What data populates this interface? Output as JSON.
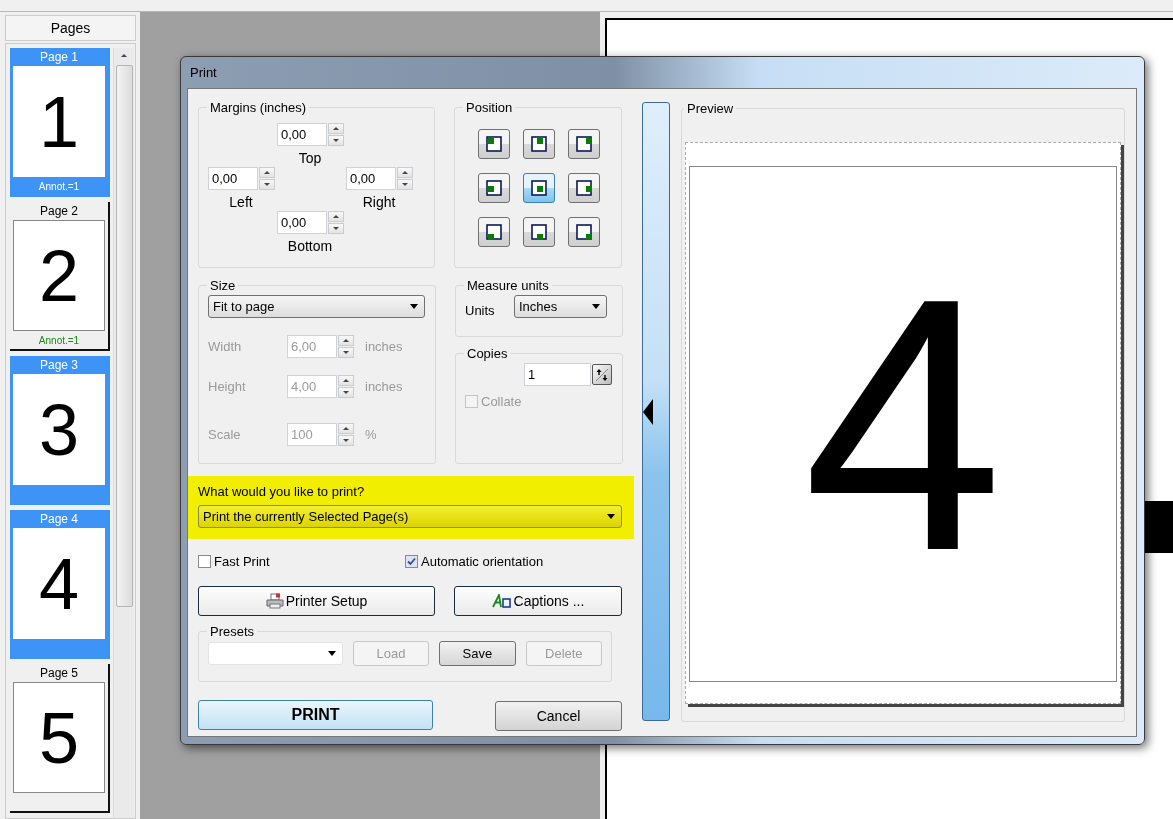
{
  "sidebar": {
    "title": "Pages",
    "pages": [
      {
        "label": "Page 1",
        "digit": "1",
        "annotation": "Annot.=1",
        "selected": true
      },
      {
        "label": "Page 2",
        "digit": "2",
        "annotation": "Annot.=1",
        "selected": false
      },
      {
        "label": "Page 3",
        "digit": "3",
        "selected": true
      },
      {
        "label": "Page 4",
        "digit": "4",
        "selected": true
      },
      {
        "label": "Page 5",
        "digit": "5",
        "selected": false
      }
    ]
  },
  "dialog": {
    "title": "Print",
    "margins": {
      "title": "Margins (inches)",
      "fields": [
        {
          "label": "Top",
          "value": "0,00"
        },
        {
          "label": "Left",
          "value": "0,00"
        },
        {
          "label": "Right",
          "value": "0,00"
        },
        {
          "label": "Bottom",
          "value": "0,00"
        }
      ]
    },
    "position": {
      "title": "Position",
      "cells": [
        {
          "selected": false
        },
        {
          "selected": false
        },
        {
          "selected": false
        },
        {
          "selected": false
        },
        {
          "selected": true
        },
        {
          "selected": false
        },
        {
          "selected": false
        },
        {
          "selected": false
        },
        {
          "selected": false
        }
      ]
    },
    "size": {
      "title": "Size",
      "mode": "Fit to page",
      "fields": [
        {
          "label": "Width",
          "value": "6,00",
          "unit": "inches",
          "disabled": true
        },
        {
          "label": "Height",
          "value": "4,00",
          "unit": "inches",
          "disabled": true
        },
        {
          "label": "Scale",
          "value": "100",
          "unit": "%",
          "disabled": true
        }
      ]
    },
    "measure_units": {
      "title": "Measure units",
      "label": "Units",
      "value": "Inches"
    },
    "copies": {
      "title": "Copies",
      "value": "1",
      "collate": {
        "label": "Collate",
        "checked": false,
        "disabled": true
      }
    },
    "print_what": {
      "question": "What would you like to print?",
      "value": "Print the currently Selected Page(s)"
    },
    "options": [
      {
        "label": "Fast Print",
        "checked": false
      },
      {
        "label": "Automatic orientation",
        "checked": true
      }
    ],
    "actions": [
      {
        "label": "Printer Setup"
      },
      {
        "label": "Captions ..."
      }
    ],
    "presets": {
      "title": "Presets",
      "buttons": [
        {
          "label": "Load",
          "disabled": true
        },
        {
          "label": "Save",
          "disabled": false
        },
        {
          "label": "Delete",
          "disabled": true
        }
      ]
    },
    "print_button": "PRINT",
    "cancel_button": "Cancel",
    "preview": {
      "title": "Preview",
      "digit": "4"
    }
  }
}
